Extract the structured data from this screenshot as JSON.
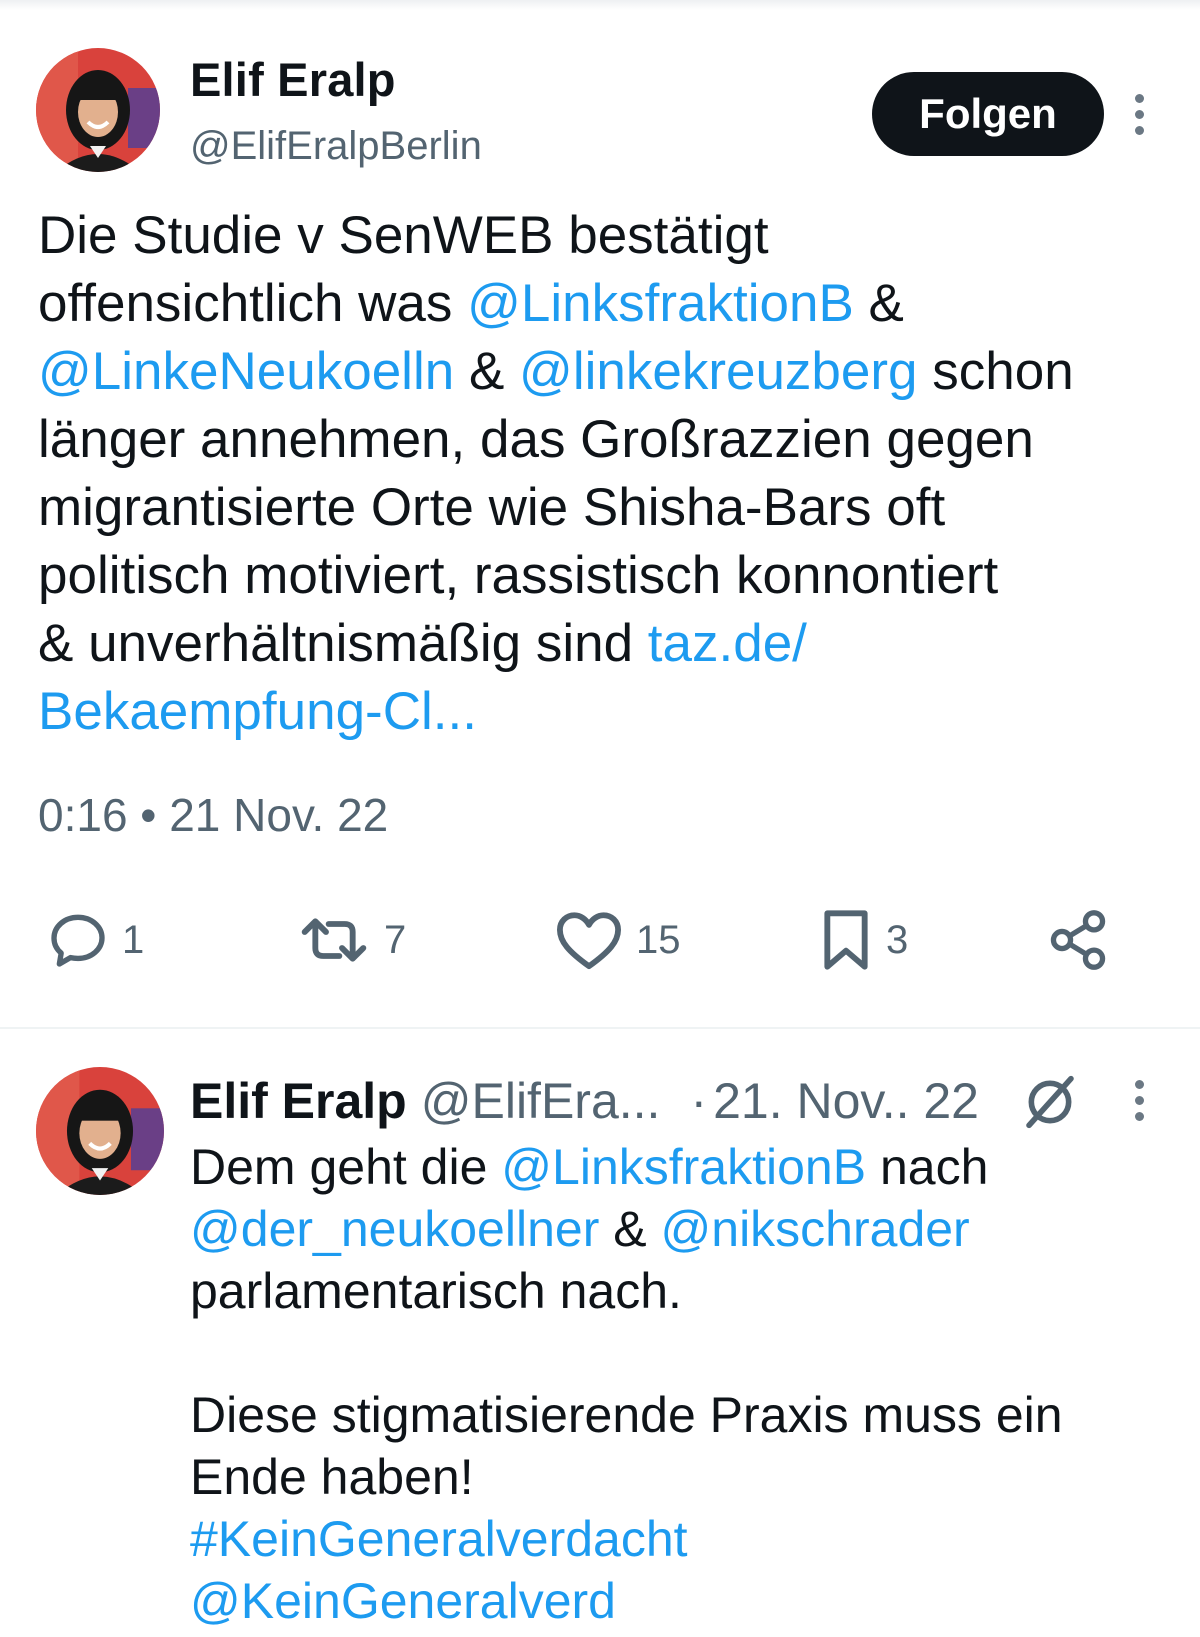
{
  "main_tweet": {
    "author_name": "Elif Eralp",
    "handle": "@ElifEralpBerlin",
    "follow_label": "Folgen",
    "text_parts": [
      {
        "text": "Die Studie v SenWEB bestätigt\noffensichtlich was ",
        "type": "plain"
      },
      {
        "text": "@LinksfraktionB",
        "type": "mention"
      },
      {
        "text": " &\n",
        "type": "plain"
      },
      {
        "text": "@LinkeNeukoelln",
        "type": "mention"
      },
      {
        "text": " & ",
        "type": "plain"
      },
      {
        "text": "@linkekreuzberg",
        "type": "mention"
      },
      {
        "text": " schon\nlänger annehmen, das Großrazzien gegen\nmigrantisierte Orte wie Shisha-Bars oft\npolitisch motiviert, rassistisch konnontiert\n& unverhältnismäßig sind ",
        "type": "plain"
      },
      {
        "text": "taz.de/\nBekaempfung-Cl...",
        "type": "link"
      }
    ],
    "timestamp": "0:16 • 21 Nov. 22",
    "actions": {
      "replies": "1",
      "retweets": "7",
      "likes": "15",
      "bookmarks": "3"
    },
    "icons": [
      "reply-icon",
      "retweet-icon",
      "heart-icon",
      "bookmark-icon",
      "share-icon"
    ]
  },
  "reply_tweet": {
    "author_name": "Elif Eralp",
    "handle": "@ElifEra...",
    "separator": "·",
    "date": "21. Nov.. 22",
    "text_parts": [
      {
        "text": "Dem geht die ",
        "type": "plain"
      },
      {
        "text": "@LinksfraktionB",
        "type": "mention"
      },
      {
        "text": " nach\n",
        "type": "plain"
      },
      {
        "text": "@der_neukoellner",
        "type": "mention"
      },
      {
        "text": " & ",
        "type": "plain"
      },
      {
        "text": "@nikschrader",
        "type": "mention"
      },
      {
        "text": "\nparlamentarisch nach.\n\nDiese stigmatisierende Praxis muss ein\nEnde haben!\n",
        "type": "plain"
      },
      {
        "text": "#KeinGeneralverdacht",
        "type": "hashtag"
      },
      {
        "text": "\n",
        "type": "plain"
      },
      {
        "text": "@KeinGeneralverd",
        "type": "mention"
      }
    ]
  },
  "colors": {
    "link": "#1d9bf0",
    "text": "#0f1419",
    "secondary": "#536471",
    "follow_bg": "#0f1419",
    "avatar_bg": "#d9423c"
  }
}
